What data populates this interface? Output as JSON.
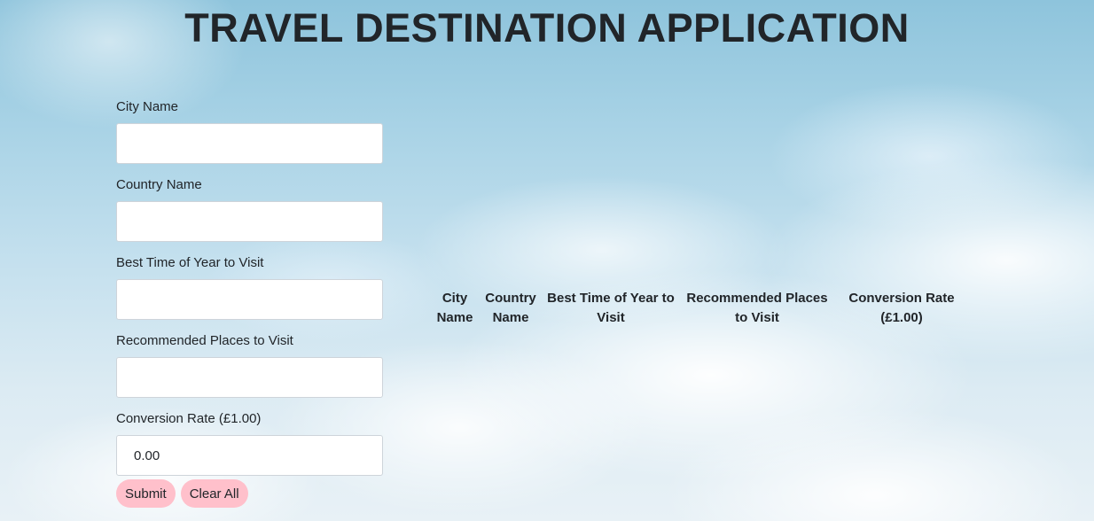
{
  "page": {
    "title": "TRAVEL DESTINATION APPLICATION"
  },
  "form": {
    "city": {
      "label": "City Name",
      "value": "",
      "placeholder": ""
    },
    "country": {
      "label": "Country Name",
      "value": "",
      "placeholder": ""
    },
    "best_time": {
      "label": "Best Time of Year to Visit",
      "value": "",
      "placeholder": ""
    },
    "places": {
      "label": "Recommended Places to Visit",
      "value": "",
      "placeholder": ""
    },
    "conversion": {
      "label": "Conversion Rate (£1.00)",
      "value": "0.00",
      "placeholder": ""
    }
  },
  "buttons": {
    "submit": "Submit",
    "clear_all": "Clear All"
  },
  "table": {
    "headers": [
      "City Name",
      "Country Name",
      "Best Time of Year to Visit",
      "Recommended Places to Visit",
      "Conversion Rate (£1.00)"
    ],
    "rows": []
  },
  "colors": {
    "button_bg": "#ffc0cb",
    "text": "#212529",
    "input_border": "#ced4da"
  }
}
